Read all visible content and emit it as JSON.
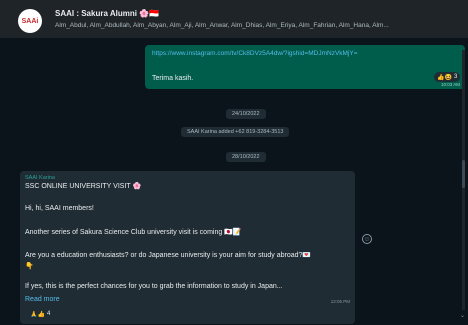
{
  "header": {
    "avatar_text": "SAAi",
    "title": "SAAI : Sakura Alumni 🌸🇮🇩",
    "members": "Alm_Abdul, Alm_Abdullah, Alm_Abyan, Alm_Aji, Alm_Anwar, Alm_Dhias, Alm_Eriya, Alm_Fahrian, Alm_Hana, Alm..."
  },
  "outgoing": {
    "link": "https://www.instagram.com/tv/Ck8DVz5A4dw/?igshid=MDJmNzVkMjY=",
    "text": "Terima kasih.",
    "time": "10:03 AM",
    "reactions": "👍😆",
    "reaction_count": "3"
  },
  "pills": {
    "date1": "24/10/2022",
    "system": "SAAI Karina added +62 819-3284-3513",
    "date2": "28/10/2022"
  },
  "incoming": {
    "sender": "SAAI Karina",
    "title": "SSC ONLINE UNIVERSITY VISIT 🌸",
    "line1": "Hi, hi, SAAI members!",
    "line2": "Another series of Sakura Science Club university visit is coming 🇯🇵📝",
    "line3": "Are you a education enthusiasts? or do Japanese university is your aim for study abroad?💌",
    "line4": "👇",
    "line5": "If yes, this is the perfect chances for you to grab the information to study in Japan...",
    "read_more": "Read more",
    "time": "12:05 PM",
    "reactions": "🙏👍",
    "reaction_count": "4"
  },
  "icons": {
    "emoji": "smiley-icon"
  }
}
